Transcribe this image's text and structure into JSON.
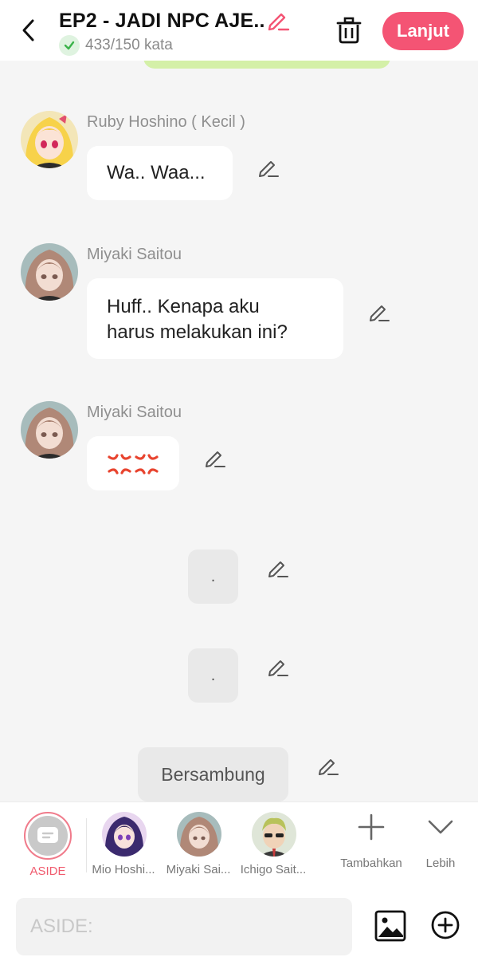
{
  "header": {
    "title": "EP2 - JADI NPC AJE..",
    "word_count": "433/150 kata",
    "next_label": "Lanjut"
  },
  "messages": [
    {
      "speaker": "Ruby Hoshino ( Kecil )",
      "text": "Wa.. Waa..."
    },
    {
      "speaker": "Miyaki Saitou",
      "text_line1": "Huff.. Kenapa aku",
      "text_line2": "harus melakukan ini?"
    },
    {
      "speaker": "Miyaki Saitou",
      "emoji": "💢💢"
    }
  ],
  "narrations": [
    {
      "text": "."
    },
    {
      "text": "."
    },
    {
      "text": "Bersambung"
    }
  ],
  "characters": {
    "aside_label": "ASIDE",
    "items": [
      {
        "label": "Mio Hoshi..."
      },
      {
        "label": "Miyaki Sai..."
      },
      {
        "label": "Ichigo Sait..."
      }
    ],
    "add_label": "Tambahkan",
    "more_label": "Lebih"
  },
  "input": {
    "placeholder": "ASIDE:"
  },
  "colors": {
    "accent": "#f45474",
    "check_green": "#3bb34a",
    "strip": "#d4f0a8"
  }
}
